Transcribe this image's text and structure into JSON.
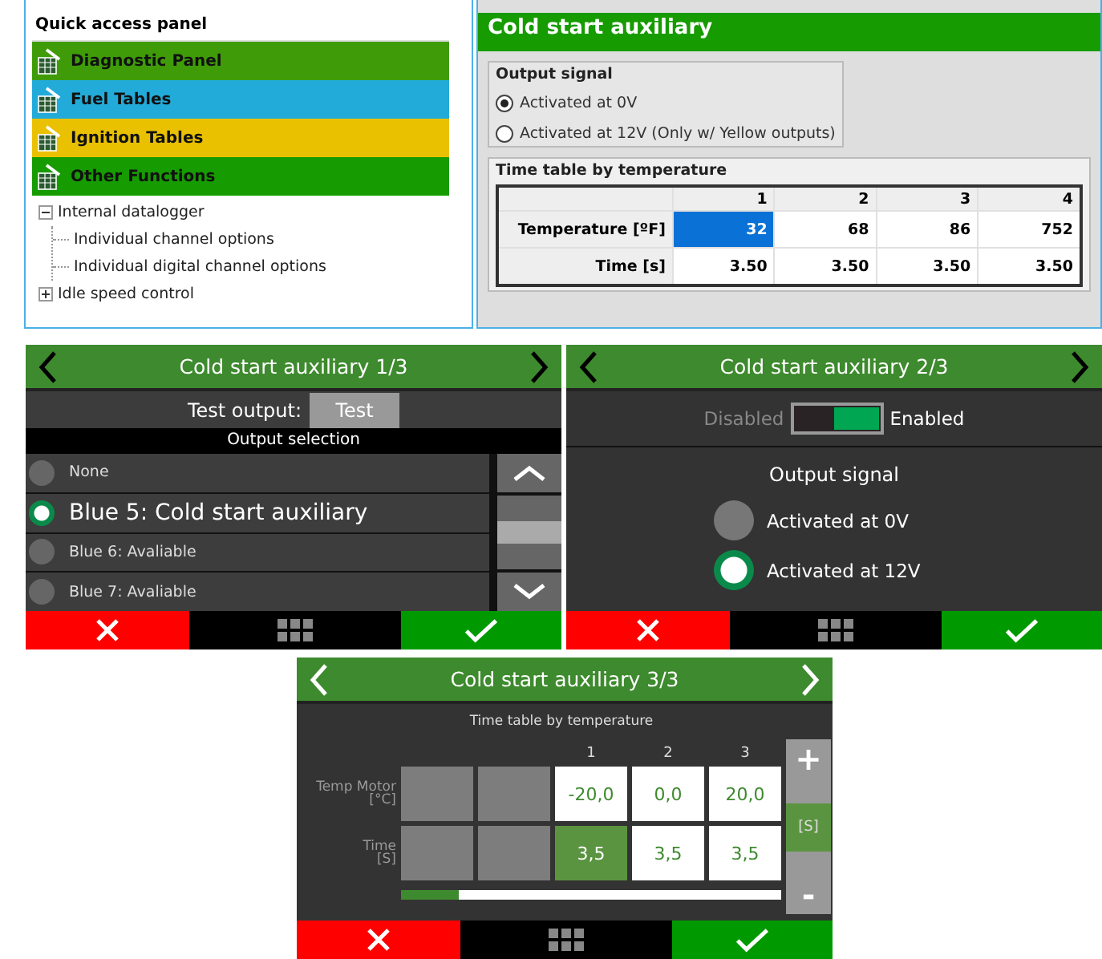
{
  "quick_access_panel": {
    "title": "Quick access panel",
    "shortcuts": [
      {
        "label": "Diagnostic Panel",
        "color": "#3f9c08"
      },
      {
        "label": "Fuel Tables",
        "color": "#22abd9"
      },
      {
        "label": "Ignition Tables",
        "color": "#eac100"
      },
      {
        "label": "Other Functions",
        "color": "#169b00"
      }
    ],
    "tree": [
      {
        "label": "Internal datalogger",
        "expanded": true,
        "children": [
          {
            "label": "Individual channel options"
          },
          {
            "label": "Individual digital channel options"
          }
        ]
      },
      {
        "label": "Idle speed control",
        "expanded": false
      }
    ]
  },
  "settings_window": {
    "title": "Cold start auxiliary",
    "output_signal": {
      "title": "Output signal",
      "options": [
        {
          "label": "Activated at 0V",
          "selected": true
        },
        {
          "label": "Activated at 12V (Only w/ Yellow outputs)",
          "selected": false
        }
      ]
    },
    "time_table": {
      "title": "Time table by temperature",
      "columns": [
        "1",
        "2",
        "3",
        "4"
      ],
      "rows": [
        {
          "label": "Temperature [ºF]",
          "cells": [
            {
              "value": "32",
              "selected": true
            },
            {
              "value": "68",
              "selected": false
            },
            {
              "value": "86",
              "selected": false
            },
            {
              "value": "752",
              "selected": false
            }
          ]
        },
        {
          "label": "Time [s]",
          "cells": [
            {
              "value": "3.50",
              "selected": false
            },
            {
              "value": "3.50",
              "selected": false
            },
            {
              "value": "3.50",
              "selected": false
            },
            {
              "value": "3.50",
              "selected": false
            }
          ]
        }
      ]
    }
  },
  "screens": [
    {
      "kind": "output_selection",
      "title": "Cold start auxiliary 1/3",
      "test_label": "Test output:",
      "test_button": "Test",
      "list_title": "Output selection",
      "options": [
        {
          "label": "None",
          "selected": false
        },
        {
          "label": "Blue 5: Cold start auxiliary",
          "selected": true
        },
        {
          "label": "Blue 6: Avaliable",
          "selected": false
        },
        {
          "label": "Blue 7: Avaliable",
          "selected": false
        }
      ]
    },
    {
      "kind": "output_signal",
      "title": "Cold start auxiliary 2/3",
      "off_label": "Disabled",
      "on_label": "Enabled",
      "on": true,
      "signal_title": "Output signal",
      "options": [
        {
          "label": "Activated at 0V",
          "selected": false
        },
        {
          "label": "Activated at 12V",
          "selected": true
        }
      ]
    },
    {
      "kind": "time_table",
      "title": "Cold start auxiliary 3/3",
      "table_title": "Time table by temperature",
      "columns": [
        "1",
        "2",
        "3"
      ],
      "rows": [
        {
          "label": "Temp Motor\n[°C]",
          "cells": [
            {
              "value": "-20,0",
              "selected": false
            },
            {
              "value": "0,0",
              "selected": false
            },
            {
              "value": "20,0",
              "selected": false
            }
          ]
        },
        {
          "label": "Time\n[S]",
          "cells": [
            {
              "value": "3,5",
              "selected": true
            },
            {
              "value": "3,5",
              "selected": false
            },
            {
              "value": "3,5",
              "selected": false
            }
          ]
        }
      ],
      "plus": "+",
      "unit": "[S]",
      "minus": "-"
    }
  ]
}
